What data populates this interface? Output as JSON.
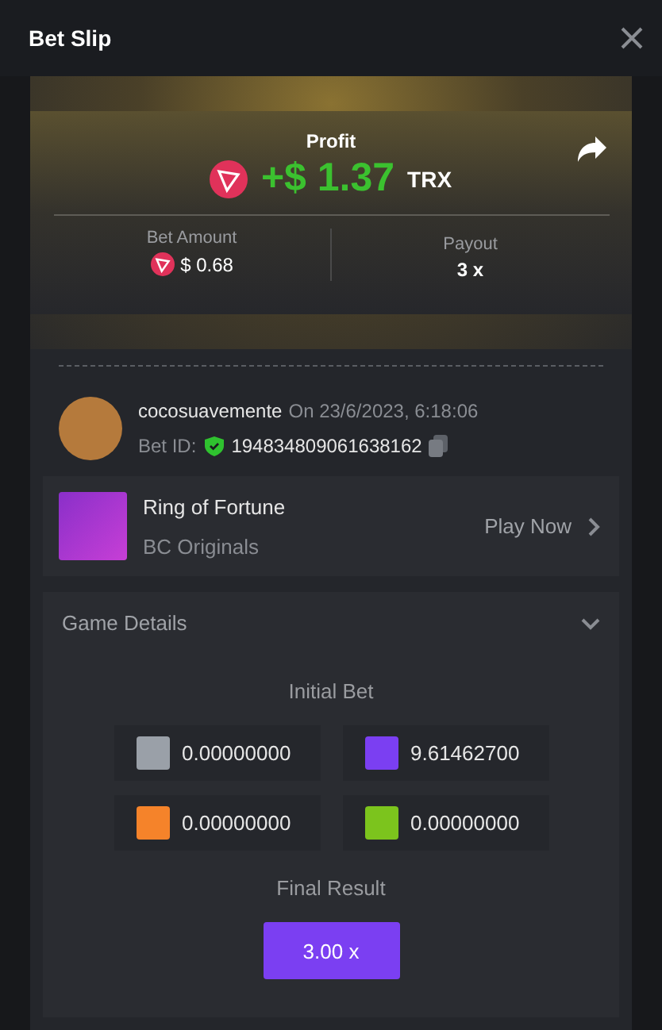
{
  "window": {
    "title": "Bet Slip"
  },
  "profit": {
    "label": "Profit",
    "amount": "+$ 1.37",
    "currency": "TRX"
  },
  "stats": [
    {
      "label": "Bet Amount",
      "value": "$ 0.68",
      "kind": "coin"
    },
    {
      "label": "Payout",
      "value": "3 x",
      "kind": "plain"
    }
  ],
  "bet": {
    "user": "cocosuavemente",
    "date": "On 23/6/2023, 6:18:06",
    "id_label": "Bet ID:",
    "id": "194834809061638162"
  },
  "game": {
    "name": "Ring of Fortune",
    "provider": "BC Originals",
    "action": "Play Now"
  },
  "details": {
    "title": "Game Details",
    "expanded": true,
    "initial_label": "Initial Bet",
    "bets": [
      {
        "color": "#9aa0a8",
        "value": "0.00000000"
      },
      {
        "color": "#7b3ff2",
        "value": "9.61462700"
      },
      {
        "color": "#f5832a",
        "value": "0.00000000"
      },
      {
        "color": "#7cc41d",
        "value": "0.00000000"
      }
    ],
    "final_label": "Final Result",
    "final_value": "3.00 x"
  }
}
